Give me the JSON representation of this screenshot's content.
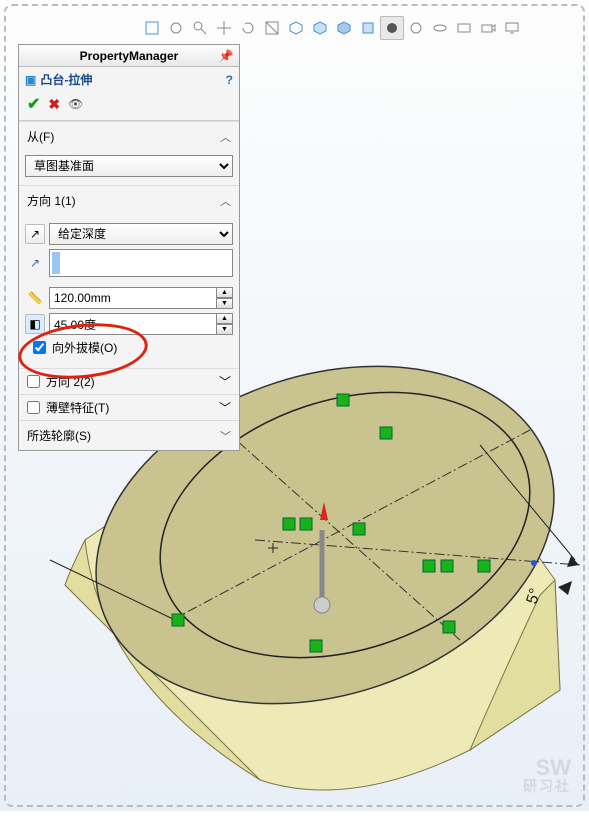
{
  "panel_title": "PropertyManager",
  "feature_name": "凸台-拉伸",
  "help_glyph": "?",
  "ok_glyph": "✔",
  "cancel_glyph": "✖",
  "sections": {
    "from": {
      "label": "从(F)",
      "value": "草图基准面"
    },
    "dir1": {
      "label": "方向 1(1)",
      "end_condition": "给定深度",
      "depth": "120.00mm",
      "draft": "45.00度",
      "draft_outward_label": "向外拔模(O)",
      "draft_outward_checked": true
    },
    "dir2": {
      "label": "方向 2(2)",
      "checked": false
    },
    "thin": {
      "label": "薄壁特征(T)",
      "checked": false
    },
    "contours": {
      "label": "所选轮廓(S)"
    }
  },
  "dimension_label": "5°",
  "watermark": {
    "big": "SW",
    "small": "研习社"
  },
  "toolbar_icons": [
    "plane-front-icon",
    "plane-back-icon",
    "zoom-icon",
    "pan-icon",
    "rotate-icon",
    "section-icon",
    "box-icon",
    "box2-icon",
    "box3-icon",
    "shaded-icon",
    "draft-icon",
    "appearance-icon",
    "eye-icon",
    "scene-icon",
    "camera-icon",
    "display-icon"
  ],
  "colors": {
    "face_top": "#c8c38f",
    "face_side": "#eeeab8",
    "face_side2": "#e2de9f",
    "edge": "#333",
    "handle": "#888",
    "marker": "#19b219",
    "arrow_red": "#d22"
  }
}
